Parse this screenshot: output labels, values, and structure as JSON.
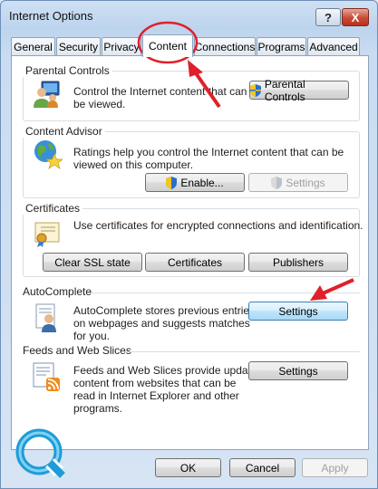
{
  "window": {
    "title": "Internet Options"
  },
  "titlebar": {
    "help_label": "?",
    "close_label": "X"
  },
  "tabs": [
    {
      "label": "General"
    },
    {
      "label": "Security"
    },
    {
      "label": "Privacy"
    },
    {
      "label": "Content",
      "active": true
    },
    {
      "label": "Connections"
    },
    {
      "label": "Programs"
    },
    {
      "label": "Advanced"
    }
  ],
  "parental": {
    "heading": "Parental Controls",
    "description_1": "Control the Internet content that can",
    "description_2": "be viewed.",
    "button": "Parental Controls"
  },
  "advisor": {
    "heading": "Content Advisor",
    "description_1": "Ratings help you control the Internet content that can be",
    "description_2": "viewed on this computer.",
    "enable_button": "Enable...",
    "settings_button": "Settings"
  },
  "certificates": {
    "heading": "Certificates",
    "description": "Use certificates for encrypted connections and identification.",
    "clear_ssl_button": "Clear SSL state",
    "certificates_button": "Certificates",
    "publishers_button": "Publishers"
  },
  "autocomplete": {
    "heading": "AutoComplete",
    "description_1": "AutoComplete stores previous entries",
    "description_2": "on webpages and suggests matches",
    "description_3": "for you.",
    "settings_button": "Settings"
  },
  "feeds": {
    "heading": "Feeds and Web Slices",
    "description_1": "Feeds and Web Slices provide updated",
    "description_2": "content from websites that can be",
    "description_3": "read in Internet Explorer and other",
    "description_4": "programs.",
    "settings_button": "Settings"
  },
  "footer": {
    "ok": "OK",
    "cancel": "Cancel",
    "apply": "Apply"
  },
  "colors": {
    "annotation_red": "#e0202a",
    "shield_blue": "#2a6fc9",
    "shield_yellow": "#f3c623"
  }
}
